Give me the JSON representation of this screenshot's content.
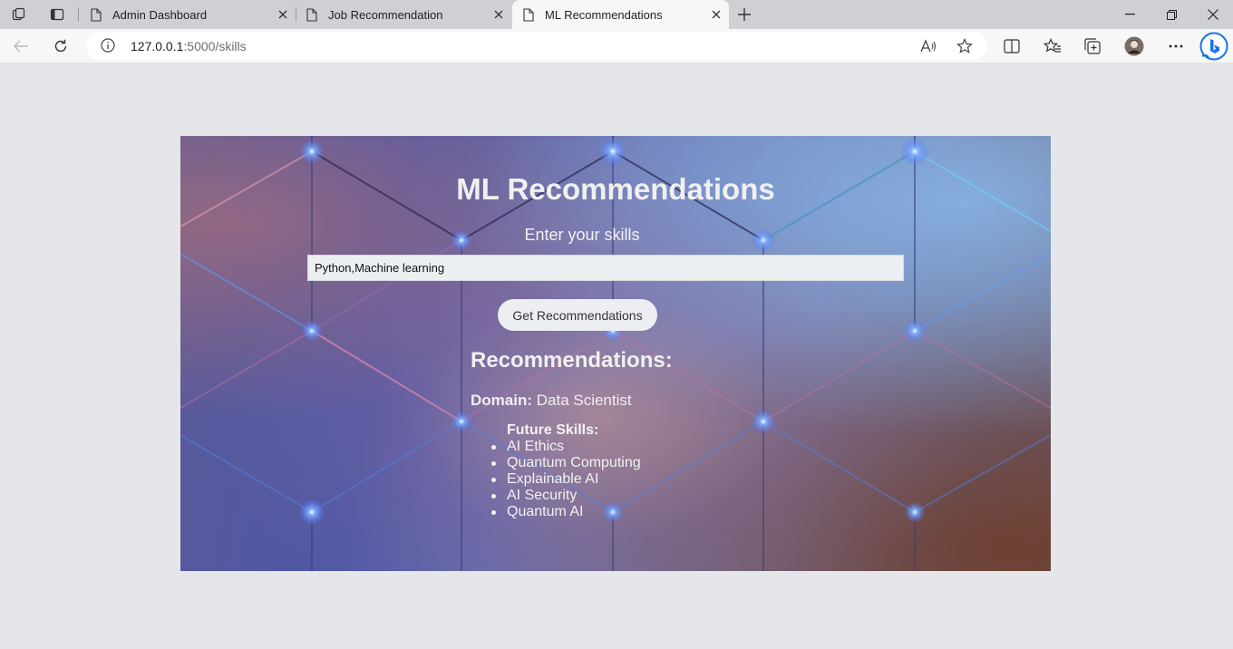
{
  "browser": {
    "tabs": [
      {
        "title": "Admin Dashboard"
      },
      {
        "title": "Job Recommendation"
      },
      {
        "title": "ML Recommendations"
      }
    ],
    "url_host": "127.0.0.1",
    "url_path": ":5000/skills"
  },
  "page": {
    "heading": "ML Recommendations",
    "prompt": "Enter your skills",
    "skills_value": "Python,Machine learning",
    "button_label": "Get Recommendations",
    "results_title": "Recommendations:",
    "domain_label": "Domain:",
    "domain_value": "Data Scientist",
    "future_label": "Future Skills:",
    "future_skills": [
      "AI Ethics",
      "Quantum Computing",
      "Explainable AI",
      "AI Security",
      "Quantum AI"
    ]
  },
  "colors": {
    "page_bg": "#e5e6ea",
    "tabstrip_bg": "#cfd0d3",
    "toolbar_bg": "#f7f7f7",
    "bing_blue": "#1a73e8"
  }
}
